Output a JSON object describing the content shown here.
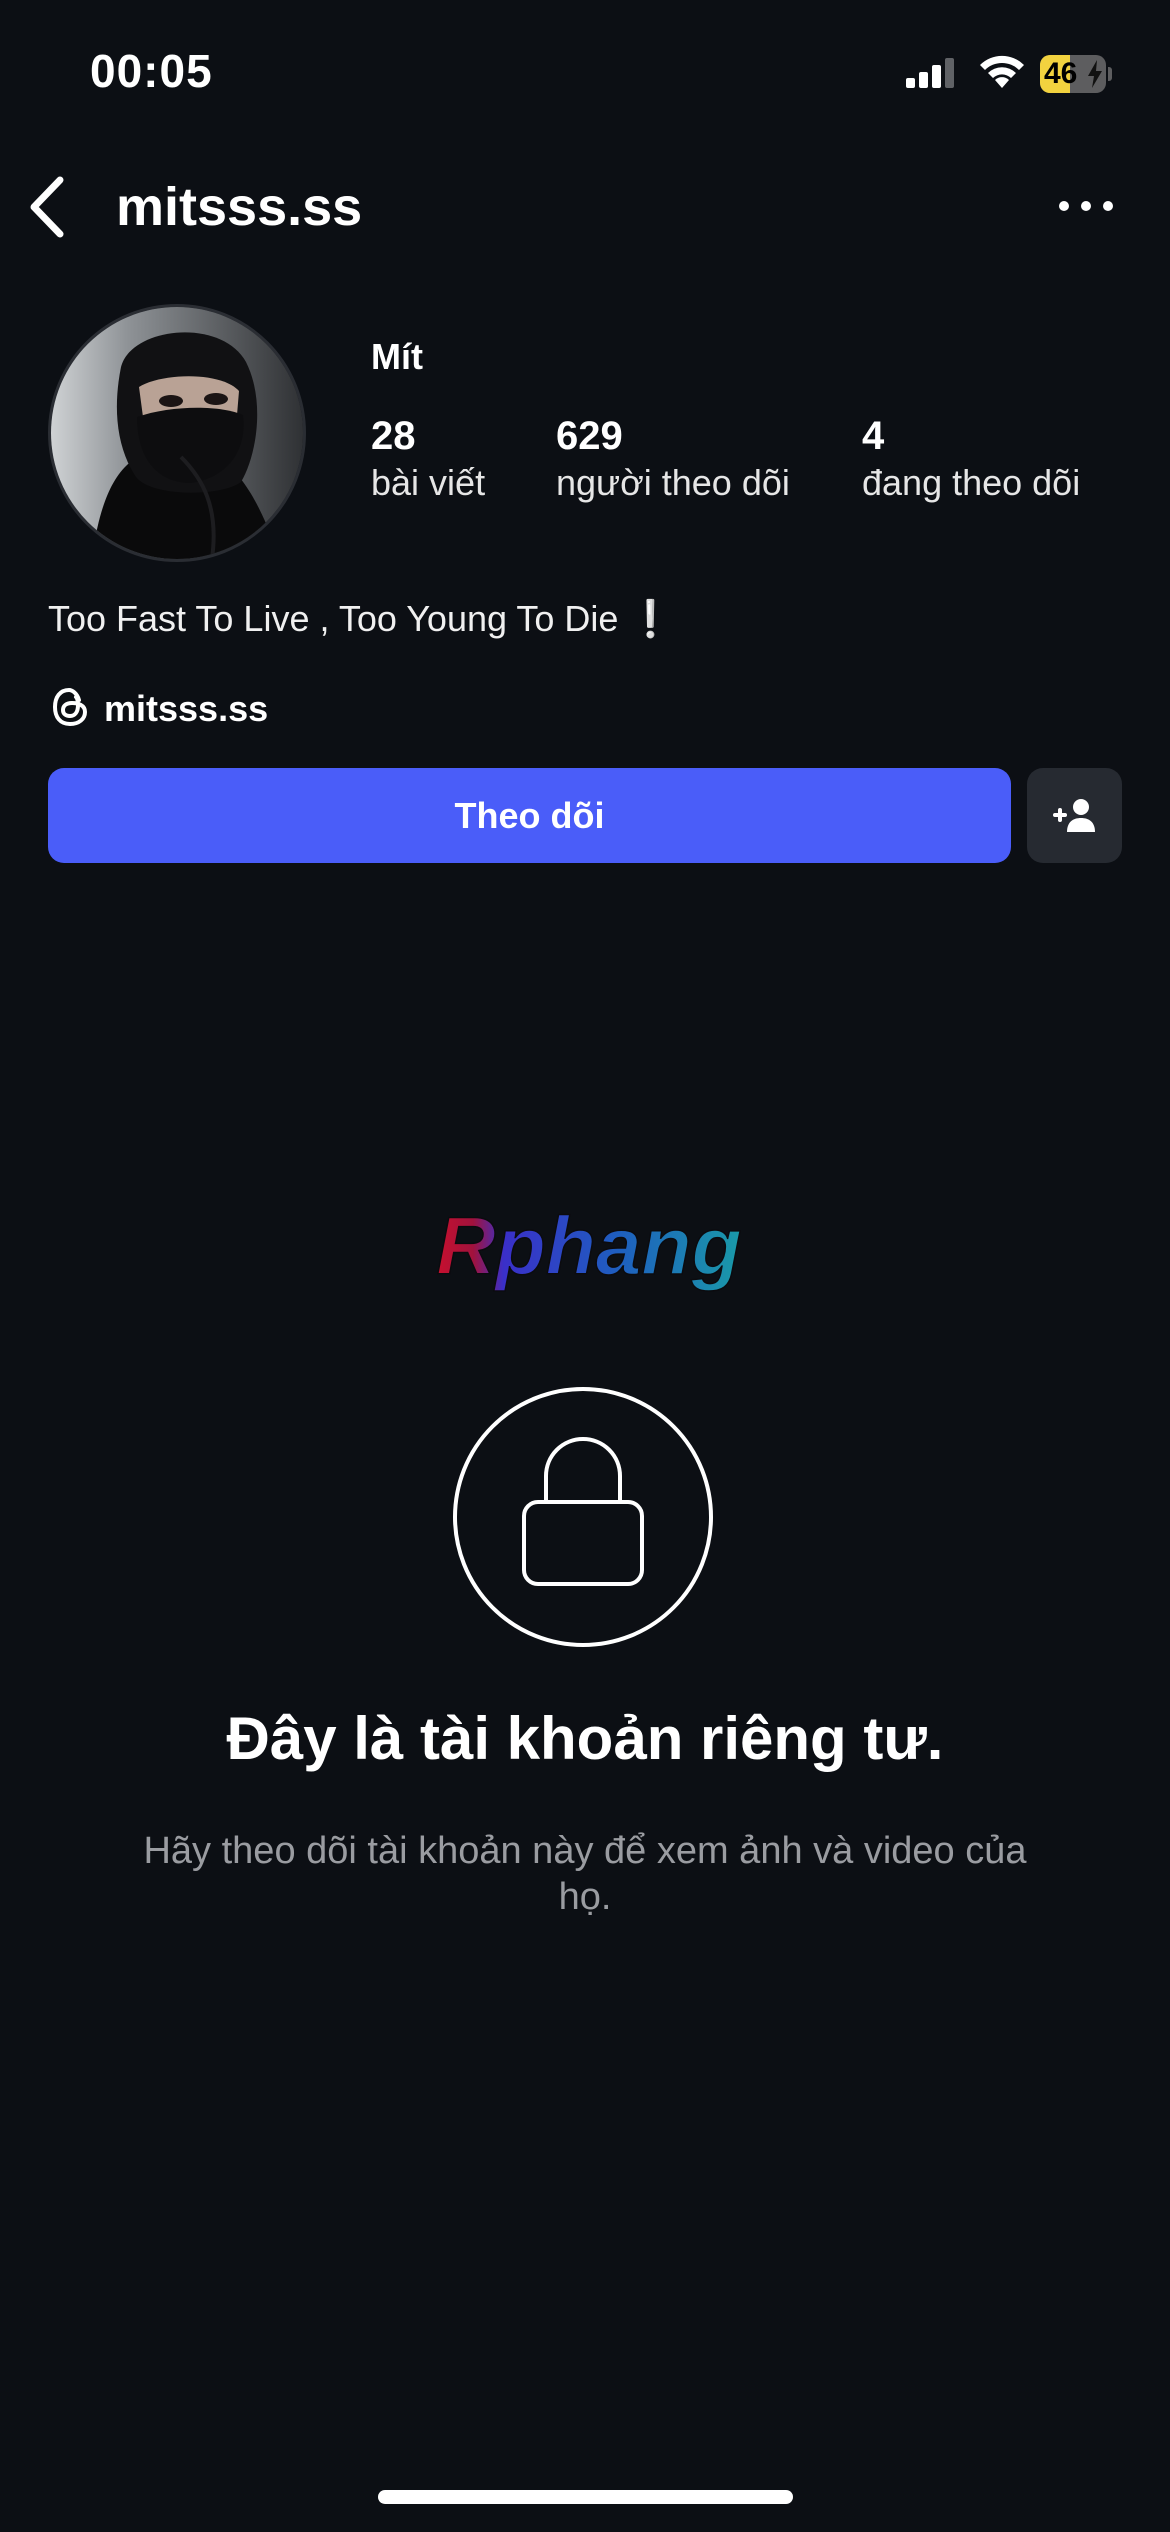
{
  "status_bar": {
    "time": "00:05",
    "battery_level": "46",
    "battery_fraction": 0.46,
    "battery_color": "#f2d23f"
  },
  "header": {
    "username": "mitsss.ss"
  },
  "profile": {
    "display_name": "Mít",
    "stats": {
      "posts": {
        "value": "28",
        "label": "bài viết"
      },
      "followers": {
        "value": "629",
        "label": "người theo dõi"
      },
      "following": {
        "value": "4",
        "label": "đang theo dõi"
      }
    },
    "bio": "Too Fast To Live , Too Young To Die ❕",
    "threads_handle": "mitsss.ss"
  },
  "actions": {
    "follow_label": "Theo dõi",
    "accent_color": "#4a5df9"
  },
  "watermark": {
    "text": "Rphang"
  },
  "private_notice": {
    "title": "Đây là tài khoản riêng tư.",
    "subtitle": "Hãy theo dõi tài khoản này để xem ảnh và video của họ."
  },
  "icons": [
    "signal-icon",
    "wifi-icon",
    "battery-icon",
    "back-arrow-icon",
    "more-icon",
    "threads-icon",
    "add-user-icon",
    "lock-icon"
  ]
}
